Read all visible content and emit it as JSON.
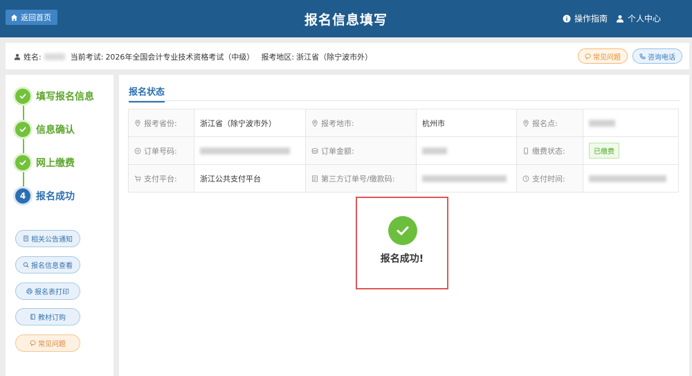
{
  "header": {
    "home_label": "返回首页",
    "title": "报名信息填写",
    "guide_label": "操作指南",
    "user_center_label": "个人中心"
  },
  "infobar": {
    "name_label": "姓名:",
    "exam_label": "当前考试:",
    "exam_value": "2026年全国会计专业技术资格考试（中级）",
    "region_label": "报考地区:",
    "region_value": "浙江省（除宁波市外）",
    "faq_label": "常见问题",
    "phone_label": "咨询电话"
  },
  "steps": [
    {
      "label": "填写报名信息",
      "state": "done"
    },
    {
      "label": "信息确认",
      "state": "done"
    },
    {
      "label": "网上缴费",
      "state": "done"
    },
    {
      "label": "报名成功",
      "state": "current",
      "number": "4"
    }
  ],
  "side_buttons": [
    {
      "label": "相关公告通知",
      "icon": "document-icon"
    },
    {
      "label": "报名信息查看",
      "icon": "search-icon"
    },
    {
      "label": "报名表打印",
      "icon": "print-icon"
    },
    {
      "label": "教材订购",
      "icon": "book-icon"
    },
    {
      "label": "常见问题",
      "icon": "chat-icon"
    }
  ],
  "main": {
    "tab_label": "报名状态",
    "rows": [
      [
        {
          "label": "报考省份:",
          "icon": "location-icon",
          "value": "浙江省（除宁波市外）"
        },
        {
          "label": "报考地市:",
          "icon": "location-icon",
          "value": "杭州市"
        },
        {
          "label": "报名点:",
          "icon": "location-icon",
          "value": ""
        }
      ],
      [
        {
          "label": "订单号码:",
          "icon": "order-icon",
          "value": ""
        },
        {
          "label": "订单金额:",
          "icon": "coin-icon",
          "value": ""
        },
        {
          "label": "缴费状态:",
          "icon": "phone-icon",
          "value": "已缴费"
        }
      ],
      [
        {
          "label": "支付平台:",
          "icon": "cart-icon",
          "value": "浙江公共支付平台"
        },
        {
          "label": "第三方订单号/缴款码:",
          "icon": "receipt-icon",
          "value": ""
        },
        {
          "label": "支付时间:",
          "icon": "clock-icon",
          "value": ""
        }
      ]
    ],
    "success_text": "报名成功!"
  },
  "colors": {
    "header_bg": "#1f5b8c",
    "step_done": "#72c23a",
    "step_current": "#2c6fb1",
    "success_border": "#e05656"
  }
}
